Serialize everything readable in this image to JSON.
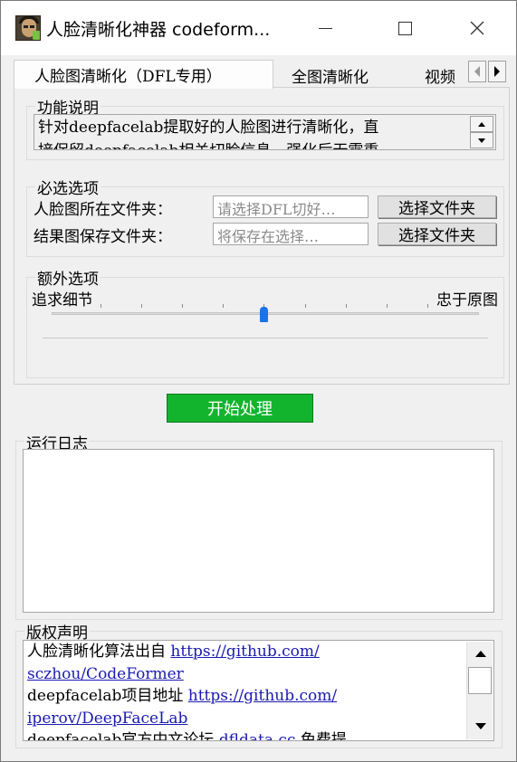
{
  "window": {
    "title": "人脸清晰化神器 codeform..."
  },
  "tabs": [
    {
      "label": "人脸图清晰化（DFL专用）"
    },
    {
      "label": "全图清晰化"
    },
    {
      "label": "视频"
    }
  ],
  "description": {
    "group_label": "功能说明",
    "lines": [
      "针对deepfacelab提取好的人脸图进行清晰化，直",
      "接保留deepfacelab相关切脸信息，强化后无需重"
    ]
  },
  "required": {
    "group_label": "必选选项",
    "face_folder_label": "人脸图所在文件夹：",
    "face_folder_placeholder": "请选择DFL切好…",
    "result_folder_label": "结果图保存文件夹：",
    "result_folder_placeholder": "将保存在选择…",
    "select_folder_button": "选择文件夹"
  },
  "extra": {
    "group_label": "额外选项",
    "slider_left_label": "追求细节",
    "slider_right_label": "忠于原图",
    "slider_level": 0.5
  },
  "start_button": "开始处理",
  "log": {
    "group_label": "运行日志"
  },
  "copyright": {
    "group_label": "版权声明",
    "line1_text": "人脸清晰化算法出自 ",
    "line1_link": "https://github.com/",
    "line2_link": "sczhou/CodeFormer",
    "line3_text": "deepfacelab项目地址 ",
    "line3_link": "https://github.com/",
    "line4_link": "iperov/DeepFaceLab",
    "line5_text": "deepfacelab官方中文论坛 ",
    "line5_link": "dfldata.cc",
    "line5_tail": "  免费提"
  },
  "icons": {
    "app": "face-photo-icon",
    "minimize": "minimize-icon",
    "maximize": "maximize-icon",
    "close": "close-icon",
    "tab_left": "chevron-left-icon",
    "tab_right": "chevron-right-icon",
    "spin_up": "spin-up-icon",
    "spin_down": "spin-down-icon",
    "scroll_up": "scroll-up-icon",
    "scroll_down": "scroll-down-icon"
  },
  "colors": {
    "start_button": "#13b42d",
    "slider_thumb": "#1a73e8",
    "link": "#1a1ab0"
  }
}
